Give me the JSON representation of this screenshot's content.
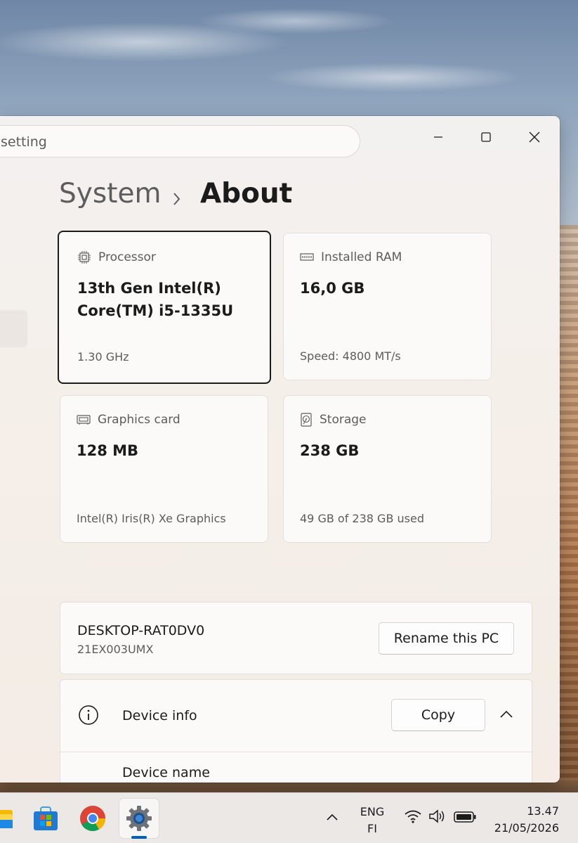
{
  "search": {
    "placeholder_partial": "setting"
  },
  "breadcrumb": {
    "parent": "System",
    "separator": "›",
    "current": "About"
  },
  "specs": [
    {
      "label": "Processor",
      "value": "13th Gen Intel(R) Core(TM) i5-1335U",
      "sub": "1.30 GHz",
      "icon": "processor-icon"
    },
    {
      "label": "Installed RAM",
      "value": "16,0 GB",
      "sub": "Speed: 4800 MT/s",
      "icon": "ram-icon"
    },
    {
      "label": "Graphics card",
      "value": "128 MB",
      "sub": "Intel(R) Iris(R) Xe Graphics",
      "icon": "graphics-card-icon"
    },
    {
      "label": "Storage",
      "value": "238 GB",
      "sub": "49 GB of 238 GB used",
      "icon": "storage-icon"
    }
  ],
  "pc": {
    "name": "DESKTOP-RAT0DV0",
    "model": "21EX003UMX",
    "rename_label": "Rename this PC"
  },
  "device_info": {
    "title": "Device info",
    "copy_label": "Copy",
    "first_row_label": "Device name"
  },
  "taskbar": {
    "language": "ENG",
    "layout": "FI",
    "time": "13.47",
    "date": "21/05/2026",
    "apps": [
      "file-explorer-icon",
      "microsoft-store-icon",
      "chrome-icon",
      "settings-icon"
    ]
  },
  "colors": {
    "accent": "#005fb8",
    "focus_border": "#1b1b1b"
  }
}
